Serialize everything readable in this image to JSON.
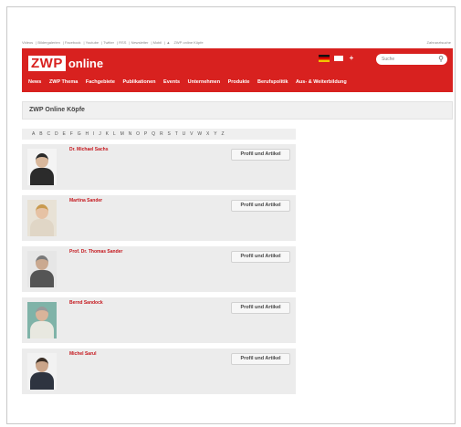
{
  "toplinks": {
    "items": [
      "Videos",
      "Bildergalerien",
      "Facebook",
      "Youtube",
      "Twitter",
      "RSS",
      "Newsletter",
      "Mobil",
      "ZWP online Köpfe"
    ],
    "right": "Zahnarztsuche"
  },
  "header": {
    "logo_zwp": "ZWP",
    "logo_online": "online",
    "search_placeholder": "Suche",
    "nav": [
      "News",
      "ZWP Thema",
      "Fachgebiete",
      "Publikationen",
      "Events",
      "Unternehmen",
      "Produkte",
      "Berufspolitik",
      "Aus- & Weiterbildung"
    ],
    "brand_color": "#d8211f"
  },
  "page": {
    "title": "ZWP Online Köpfe"
  },
  "alphabet": [
    "A",
    "B",
    "C",
    "D",
    "E",
    "F",
    "G",
    "H",
    "I",
    "J",
    "K",
    "L",
    "M",
    "N",
    "O",
    "P",
    "Q",
    "R",
    "S",
    "T",
    "U",
    "V",
    "W",
    "X",
    "Y",
    "Z"
  ],
  "entries": [
    {
      "name": "Dr. Michael Sachs",
      "button": "Profil und Artikel",
      "bg": "#f4f4f4",
      "hair": "#2a2a2a",
      "skin": "#d9b89c",
      "suit": "#2b2b2b"
    },
    {
      "name": "Martina Sander",
      "button": "Profil und Artikel",
      "bg": "#e8e2d6",
      "hair": "#c99a4e",
      "skin": "#e6c2a4",
      "suit": "#e0d6c6"
    },
    {
      "name": "Prof. Dr. Thomas Sander",
      "button": "Profil und Artikel",
      "bg": "#e6e6e6",
      "hair": "#7a7a7a",
      "skin": "#caa990",
      "suit": "#555555"
    },
    {
      "name": "Bernd Sandock",
      "button": "Profil und Artikel",
      "bg": "#7fb3a8",
      "hair": "#9a9a9a",
      "skin": "#d9b49a",
      "suit": "#e8e8e0"
    },
    {
      "name": "Michel Sarul",
      "button": "Profil und Artikel",
      "bg": "#f2f2f2",
      "hair": "#3a2e25",
      "skin": "#caa58a",
      "suit": "#2e3440"
    }
  ]
}
